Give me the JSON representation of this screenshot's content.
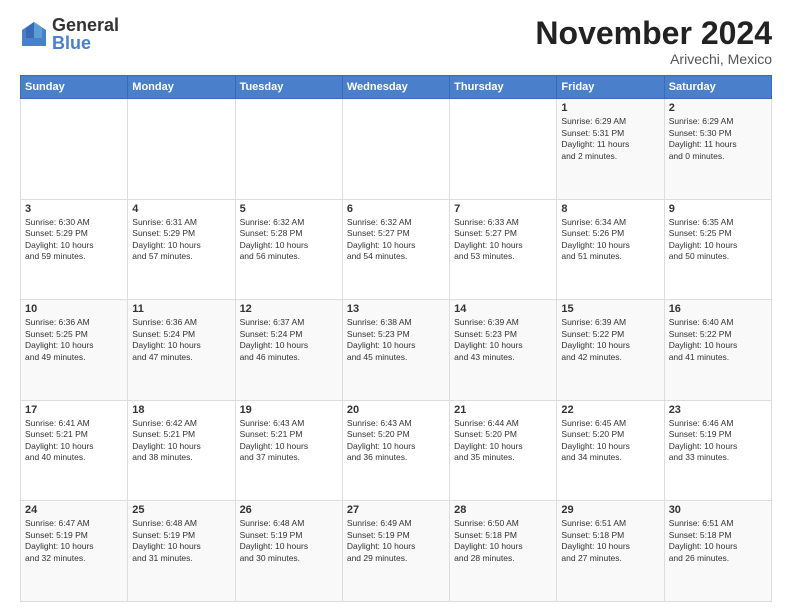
{
  "logo": {
    "general": "General",
    "blue": "Blue"
  },
  "title": "November 2024",
  "location": "Arivechi, Mexico",
  "days_of_week": [
    "Sunday",
    "Monday",
    "Tuesday",
    "Wednesday",
    "Thursday",
    "Friday",
    "Saturday"
  ],
  "weeks": [
    [
      {
        "day": "",
        "info": ""
      },
      {
        "day": "",
        "info": ""
      },
      {
        "day": "",
        "info": ""
      },
      {
        "day": "",
        "info": ""
      },
      {
        "day": "",
        "info": ""
      },
      {
        "day": "1",
        "info": "Sunrise: 6:29 AM\nSunset: 5:31 PM\nDaylight: 11 hours\nand 2 minutes."
      },
      {
        "day": "2",
        "info": "Sunrise: 6:29 AM\nSunset: 5:30 PM\nDaylight: 11 hours\nand 0 minutes."
      }
    ],
    [
      {
        "day": "3",
        "info": "Sunrise: 6:30 AM\nSunset: 5:29 PM\nDaylight: 10 hours\nand 59 minutes."
      },
      {
        "day": "4",
        "info": "Sunrise: 6:31 AM\nSunset: 5:29 PM\nDaylight: 10 hours\nand 57 minutes."
      },
      {
        "day": "5",
        "info": "Sunrise: 6:32 AM\nSunset: 5:28 PM\nDaylight: 10 hours\nand 56 minutes."
      },
      {
        "day": "6",
        "info": "Sunrise: 6:32 AM\nSunset: 5:27 PM\nDaylight: 10 hours\nand 54 minutes."
      },
      {
        "day": "7",
        "info": "Sunrise: 6:33 AM\nSunset: 5:27 PM\nDaylight: 10 hours\nand 53 minutes."
      },
      {
        "day": "8",
        "info": "Sunrise: 6:34 AM\nSunset: 5:26 PM\nDaylight: 10 hours\nand 51 minutes."
      },
      {
        "day": "9",
        "info": "Sunrise: 6:35 AM\nSunset: 5:25 PM\nDaylight: 10 hours\nand 50 minutes."
      }
    ],
    [
      {
        "day": "10",
        "info": "Sunrise: 6:36 AM\nSunset: 5:25 PM\nDaylight: 10 hours\nand 49 minutes."
      },
      {
        "day": "11",
        "info": "Sunrise: 6:36 AM\nSunset: 5:24 PM\nDaylight: 10 hours\nand 47 minutes."
      },
      {
        "day": "12",
        "info": "Sunrise: 6:37 AM\nSunset: 5:24 PM\nDaylight: 10 hours\nand 46 minutes."
      },
      {
        "day": "13",
        "info": "Sunrise: 6:38 AM\nSunset: 5:23 PM\nDaylight: 10 hours\nand 45 minutes."
      },
      {
        "day": "14",
        "info": "Sunrise: 6:39 AM\nSunset: 5:23 PM\nDaylight: 10 hours\nand 43 minutes."
      },
      {
        "day": "15",
        "info": "Sunrise: 6:39 AM\nSunset: 5:22 PM\nDaylight: 10 hours\nand 42 minutes."
      },
      {
        "day": "16",
        "info": "Sunrise: 6:40 AM\nSunset: 5:22 PM\nDaylight: 10 hours\nand 41 minutes."
      }
    ],
    [
      {
        "day": "17",
        "info": "Sunrise: 6:41 AM\nSunset: 5:21 PM\nDaylight: 10 hours\nand 40 minutes."
      },
      {
        "day": "18",
        "info": "Sunrise: 6:42 AM\nSunset: 5:21 PM\nDaylight: 10 hours\nand 38 minutes."
      },
      {
        "day": "19",
        "info": "Sunrise: 6:43 AM\nSunset: 5:21 PM\nDaylight: 10 hours\nand 37 minutes."
      },
      {
        "day": "20",
        "info": "Sunrise: 6:43 AM\nSunset: 5:20 PM\nDaylight: 10 hours\nand 36 minutes."
      },
      {
        "day": "21",
        "info": "Sunrise: 6:44 AM\nSunset: 5:20 PM\nDaylight: 10 hours\nand 35 minutes."
      },
      {
        "day": "22",
        "info": "Sunrise: 6:45 AM\nSunset: 5:20 PM\nDaylight: 10 hours\nand 34 minutes."
      },
      {
        "day": "23",
        "info": "Sunrise: 6:46 AM\nSunset: 5:19 PM\nDaylight: 10 hours\nand 33 minutes."
      }
    ],
    [
      {
        "day": "24",
        "info": "Sunrise: 6:47 AM\nSunset: 5:19 PM\nDaylight: 10 hours\nand 32 minutes."
      },
      {
        "day": "25",
        "info": "Sunrise: 6:48 AM\nSunset: 5:19 PM\nDaylight: 10 hours\nand 31 minutes."
      },
      {
        "day": "26",
        "info": "Sunrise: 6:48 AM\nSunset: 5:19 PM\nDaylight: 10 hours\nand 30 minutes."
      },
      {
        "day": "27",
        "info": "Sunrise: 6:49 AM\nSunset: 5:19 PM\nDaylight: 10 hours\nand 29 minutes."
      },
      {
        "day": "28",
        "info": "Sunrise: 6:50 AM\nSunset: 5:18 PM\nDaylight: 10 hours\nand 28 minutes."
      },
      {
        "day": "29",
        "info": "Sunrise: 6:51 AM\nSunset: 5:18 PM\nDaylight: 10 hours\nand 27 minutes."
      },
      {
        "day": "30",
        "info": "Sunrise: 6:51 AM\nSunset: 5:18 PM\nDaylight: 10 hours\nand 26 minutes."
      }
    ]
  ]
}
